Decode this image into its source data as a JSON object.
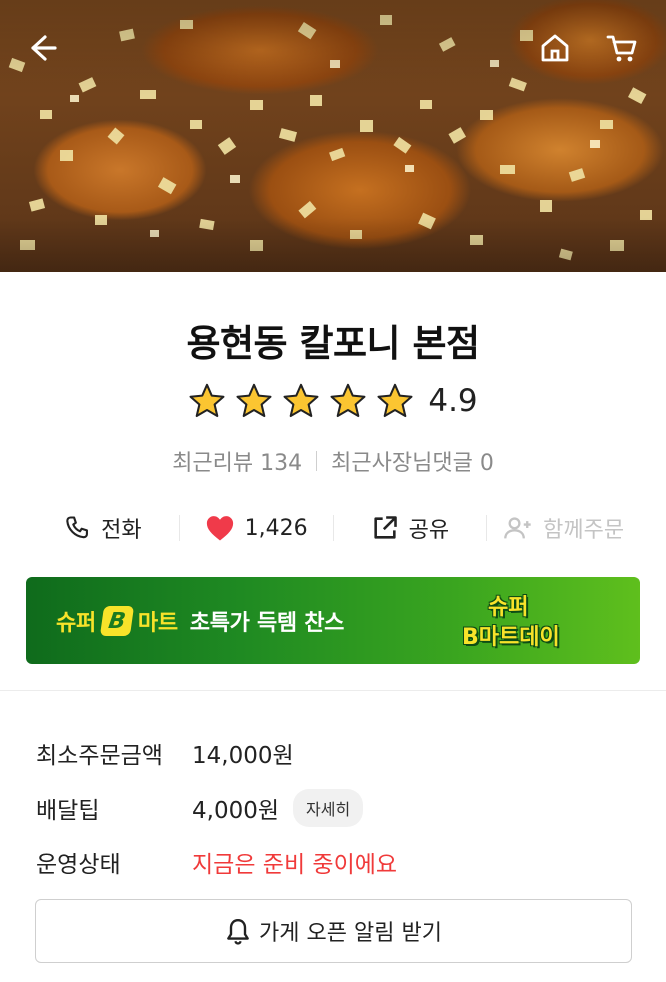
{
  "hero": {
    "back_icon": "arrow-left-icon",
    "home_icon": "home-icon",
    "cart_icon": "cart-icon"
  },
  "store": {
    "name": "용현동 칼포니 본점",
    "rating": "4.9",
    "star_count": 5,
    "recent_reviews": "최근리뷰 134",
    "owner_replies": "최근사장님댓글 0"
  },
  "actions": {
    "call_label": "전화",
    "like_count": "1,426",
    "share_label": "공유",
    "group_order_label": "함께주문",
    "like_color": "#f03a4a"
  },
  "banner": {
    "text_super": "슈퍼",
    "text_b": "B",
    "text_mart": "마트",
    "text_rest": "초특가 득템 찬스",
    "logo_line1": "슈퍼",
    "logo_line2": "B마트데이"
  },
  "info": {
    "min_order_label": "최소주문금액",
    "min_order_value": "14,000원",
    "delivery_tip_label": "배달팁",
    "delivery_tip_value": "4,000원",
    "detail_label": "자세히",
    "status_label": "운영상태",
    "status_value": "지금은 준비 중이에요",
    "status_color": "#f03a3a"
  },
  "notify": {
    "label": "가게 오픈 알림 받기",
    "icon": "bell-icon"
  }
}
